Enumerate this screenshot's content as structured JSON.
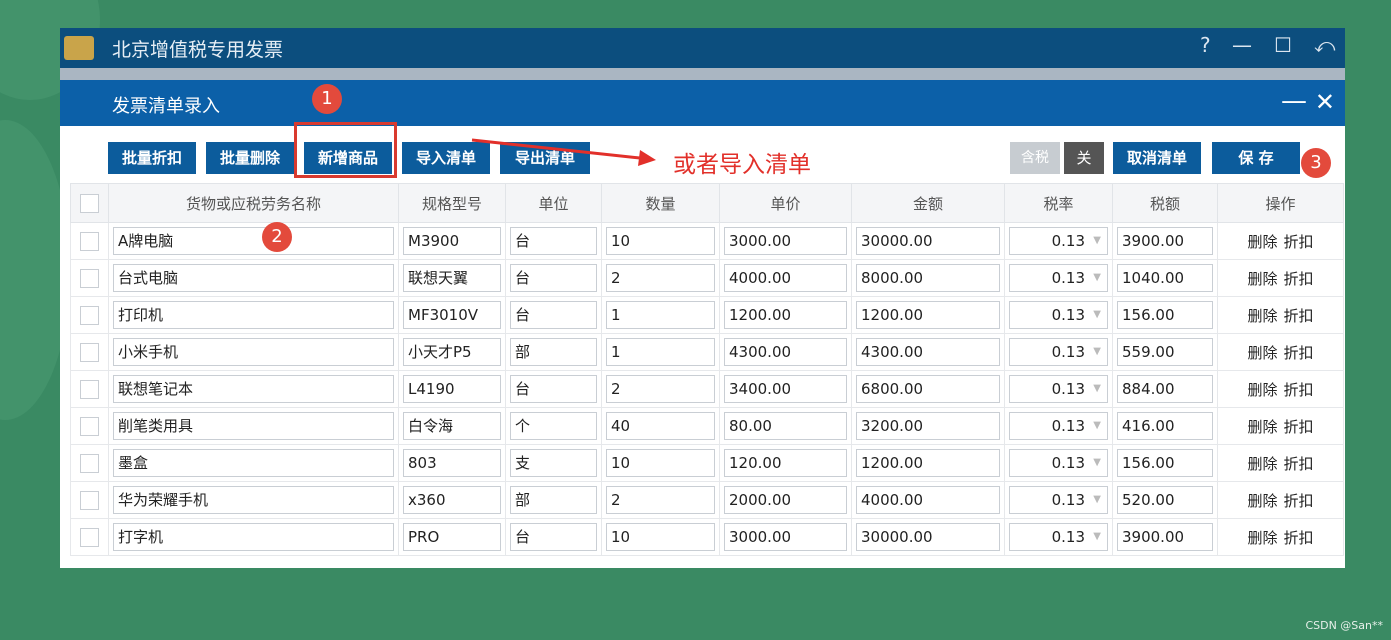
{
  "window": {
    "title": "北京增值税专用发票",
    "controls": [
      "?",
      "—",
      "☐",
      "⤺"
    ]
  },
  "dialog": {
    "title": "发票清单录入",
    "minimize": "—",
    "close": "✕"
  },
  "toolbar": {
    "batch_discount": "批量折扣",
    "batch_delete": "批量删除",
    "add_product": "新增商品",
    "import_list": "导入清单",
    "export_list": "导出清单",
    "tax_label": "含税",
    "tax_toggle": "关",
    "cancel_list": "取消清单",
    "save": "保 存"
  },
  "annotations": {
    "n1": "1",
    "n2": "2",
    "n3": "3",
    "arrow_text": "或者导入清单"
  },
  "table": {
    "headers": [
      "货物或应税劳务名称",
      "规格型号",
      "单位",
      "数量",
      "单价",
      "金额",
      "税率",
      "税额",
      "操作"
    ],
    "row_ops": {
      "delete": "删除",
      "discount": "折扣"
    },
    "rows": [
      {
        "name": "A牌电脑",
        "model": "M3900",
        "unit": "台",
        "qty": "10",
        "price": "3000.00",
        "amount": "30000.00",
        "rate": "0.13",
        "tax": "3900.00"
      },
      {
        "name": "台式电脑",
        "model": "联想天翼",
        "unit": "台",
        "qty": "2",
        "price": "4000.00",
        "amount": "8000.00",
        "rate": "0.13",
        "tax": "1040.00"
      },
      {
        "name": "打印机",
        "model": "MF3010V",
        "unit": "台",
        "qty": "1",
        "price": "1200.00",
        "amount": "1200.00",
        "rate": "0.13",
        "tax": "156.00"
      },
      {
        "name": "小米手机",
        "model": "小天才P5",
        "unit": "部",
        "qty": "1",
        "price": "4300.00",
        "amount": "4300.00",
        "rate": "0.13",
        "tax": "559.00"
      },
      {
        "name": "联想笔记本",
        "model": "L4190",
        "unit": "台",
        "qty": "2",
        "price": "3400.00",
        "amount": "6800.00",
        "rate": "0.13",
        "tax": "884.00"
      },
      {
        "name": "削笔类用具",
        "model": "白令海",
        "unit": "个",
        "qty": "40",
        "price": "80.00",
        "amount": "3200.00",
        "rate": "0.13",
        "tax": "416.00"
      },
      {
        "name": "墨盒",
        "model": "803",
        "unit": "支",
        "qty": "10",
        "price": "120.00",
        "amount": "1200.00",
        "rate": "0.13",
        "tax": "156.00"
      },
      {
        "name": "华为荣耀手机",
        "model": "x360",
        "unit": "部",
        "qty": "2",
        "price": "2000.00",
        "amount": "4000.00",
        "rate": "0.13",
        "tax": "520.00"
      },
      {
        "name": "打字机",
        "model": "PRO",
        "unit": "台",
        "qty": "10",
        "price": "3000.00",
        "amount": "30000.00",
        "rate": "0.13",
        "tax": "3900.00"
      }
    ]
  },
  "watermark": "CSDN @San**",
  "colors": {
    "titlebar": "#0c4e7e",
    "dialog_bar": "#0c60a8",
    "button": "#0c5c9c",
    "annotation_red": "#e34a3c",
    "background": "#3a8a63"
  }
}
